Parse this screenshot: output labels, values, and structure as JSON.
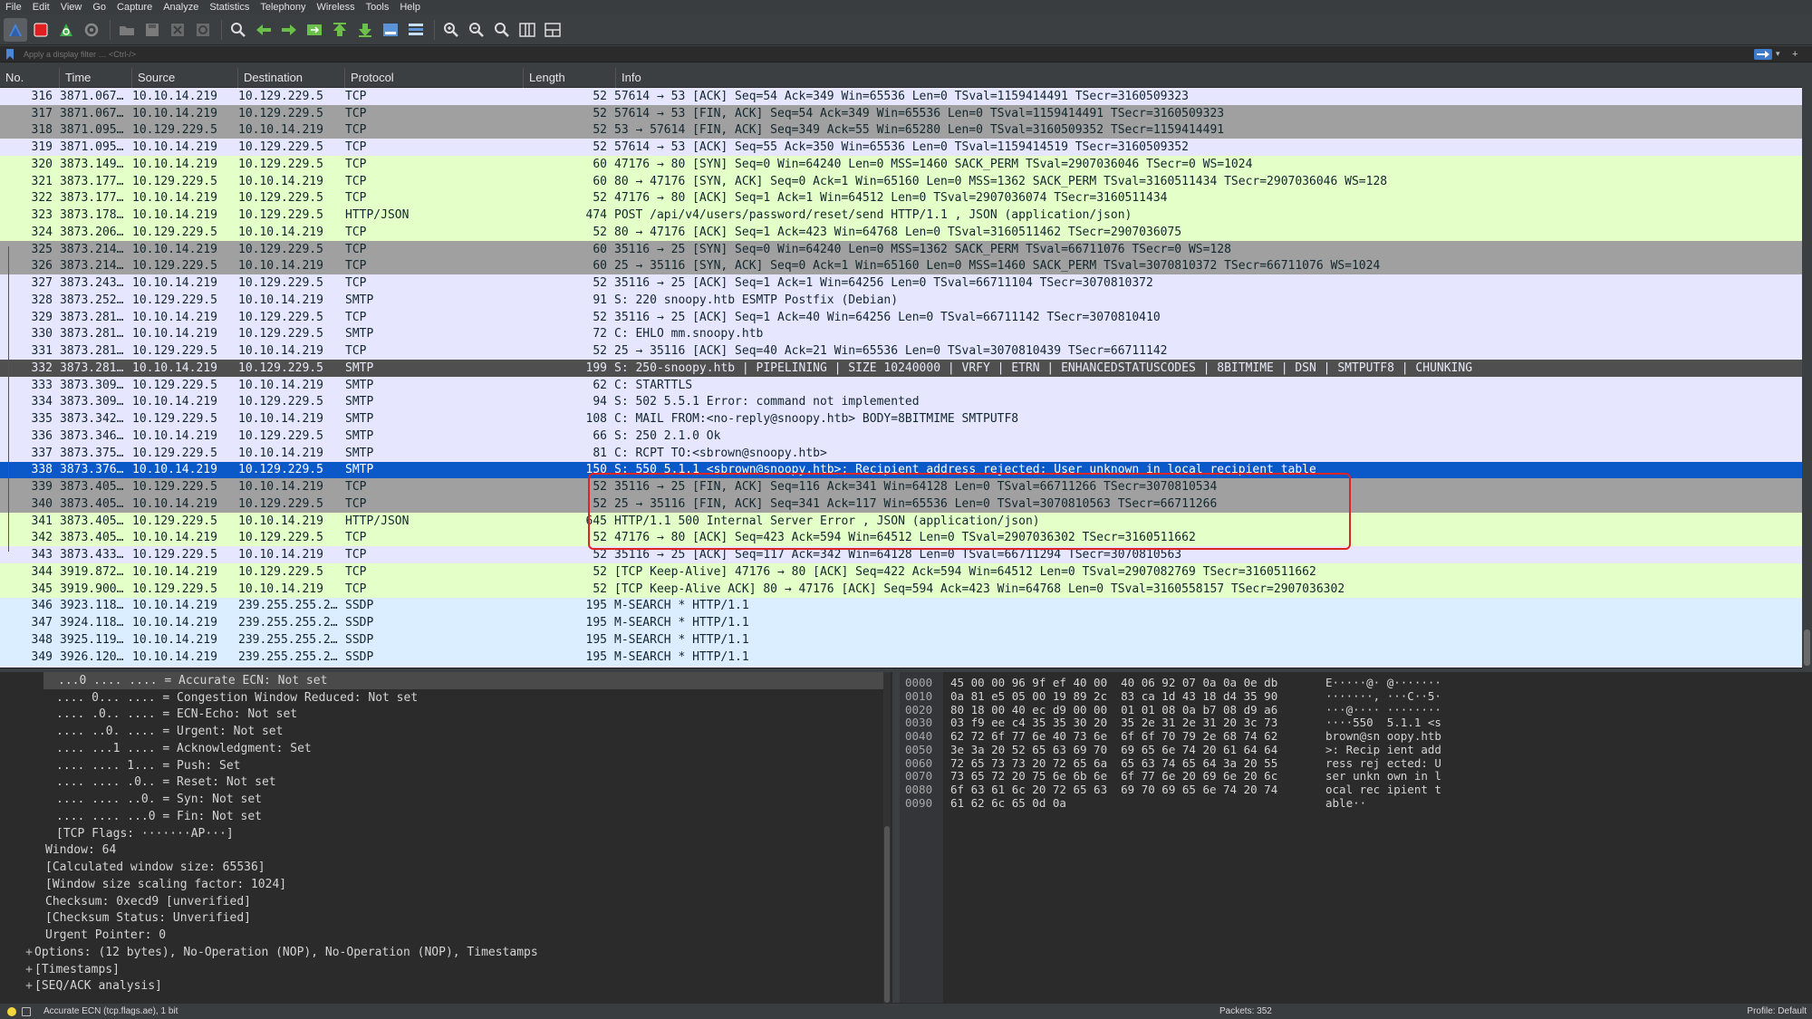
{
  "menu": [
    "File",
    "Edit",
    "View",
    "Go",
    "Capture",
    "Analyze",
    "Statistics",
    "Telephony",
    "Wireless",
    "Tools",
    "Help"
  ],
  "toolbar": {
    "icons": [
      "shark-fin-start-icon",
      "stop-icon",
      "restart-icon",
      "options-gear-icon",
      "open-folder-icon",
      "save-icon",
      "close-file-icon",
      "reload-icon",
      "find-icon",
      "back-arrow-icon",
      "forward-arrow-icon",
      "goto-packet-icon",
      "first-packet-icon",
      "last-packet-icon",
      "autoscroll-icon",
      "colorize-icon",
      "zoom-in-icon",
      "zoom-out-icon",
      "normal-size-icon",
      "resize-columns-icon",
      "layout-icon"
    ]
  },
  "filter": {
    "placeholder": "Apply a display filter … <Ctrl-/>"
  },
  "columns": {
    "no": "No.",
    "time": "Time",
    "source": "Source",
    "destination": "Destination",
    "protocol": "Protocol",
    "length": "Length",
    "info": "Info"
  },
  "colors": {
    "tcp_light": "#e7e6ff",
    "tcp_dark": "#a0a0a0",
    "http": "#e4ffc7",
    "ssdp": "#daeeff",
    "smtp": "#e7e6ff",
    "selected": "#0b58c8",
    "marked_dark": "#4f4f4f",
    "highlight": "#e02424"
  },
  "packets": [
    {
      "no": "316",
      "time": "3871.067…",
      "src": "10.10.14.219",
      "dst": "10.129.229.5",
      "proto": "TCP",
      "len": "52",
      "info": "57614 → 53 [ACK] Seq=54 Ack=349 Win=65536 Len=0 TSval=1159414491 TSecr=3160509323",
      "bg": "#e7e6ff",
      "fg": "#12272e"
    },
    {
      "no": "317",
      "time": "3871.067…",
      "src": "10.10.14.219",
      "dst": "10.129.229.5",
      "proto": "TCP",
      "len": "52",
      "info": "57614 → 53 [FIN, ACK] Seq=54 Ack=349 Win=65536 Len=0 TSval=1159414491 TSecr=3160509323",
      "bg": "#a0a0a0",
      "fg": "#12272e"
    },
    {
      "no": "318",
      "time": "3871.095…",
      "src": "10.129.229.5",
      "dst": "10.10.14.219",
      "proto": "TCP",
      "len": "52",
      "info": "53 → 57614 [FIN, ACK] Seq=349 Ack=55 Win=65280 Len=0 TSval=3160509352 TSecr=1159414491",
      "bg": "#a0a0a0",
      "fg": "#12272e"
    },
    {
      "no": "319",
      "time": "3871.095…",
      "src": "10.10.14.219",
      "dst": "10.129.229.5",
      "proto": "TCP",
      "len": "52",
      "info": "57614 → 53 [ACK] Seq=55 Ack=350 Win=65536 Len=0 TSval=1159414519 TSecr=3160509352",
      "bg": "#e7e6ff",
      "fg": "#12272e"
    },
    {
      "no": "320",
      "time": "3873.149…",
      "src": "10.10.14.219",
      "dst": "10.129.229.5",
      "proto": "TCP",
      "len": "60",
      "info": "47176 → 80 [SYN] Seq=0 Win=64240 Len=0 MSS=1460 SACK_PERM TSval=2907036046 TSecr=0 WS=1024",
      "bg": "#e4ffc7",
      "fg": "#12272e"
    },
    {
      "no": "321",
      "time": "3873.177…",
      "src": "10.129.229.5",
      "dst": "10.10.14.219",
      "proto": "TCP",
      "len": "60",
      "info": "80 → 47176 [SYN, ACK] Seq=0 Ack=1 Win=65160 Len=0 MSS=1362 SACK_PERM TSval=3160511434 TSecr=2907036046 WS=128",
      "bg": "#e4ffc7",
      "fg": "#12272e"
    },
    {
      "no": "322",
      "time": "3873.177…",
      "src": "10.10.14.219",
      "dst": "10.129.229.5",
      "proto": "TCP",
      "len": "52",
      "info": "47176 → 80 [ACK] Seq=1 Ack=1 Win=64512 Len=0 TSval=2907036074 TSecr=3160511434",
      "bg": "#e4ffc7",
      "fg": "#12272e"
    },
    {
      "no": "323",
      "time": "3873.178…",
      "src": "10.10.14.219",
      "dst": "10.129.229.5",
      "proto": "HTTP/JSON",
      "len": "474",
      "info": "POST /api/v4/users/password/reset/send HTTP/1.1 , JSON (application/json)",
      "bg": "#e4ffc7",
      "fg": "#12272e"
    },
    {
      "no": "324",
      "time": "3873.206…",
      "src": "10.129.229.5",
      "dst": "10.10.14.219",
      "proto": "TCP",
      "len": "52",
      "info": "80 → 47176 [ACK] Seq=1 Ack=423 Win=64768 Len=0 TSval=3160511462 TSecr=2907036075",
      "bg": "#e4ffc7",
      "fg": "#12272e"
    },
    {
      "no": "325",
      "time": "3873.214…",
      "src": "10.10.14.219",
      "dst": "10.129.229.5",
      "proto": "TCP",
      "len": "60",
      "info": "35116 → 25 [SYN] Seq=0 Win=64240 Len=0 MSS=1362 SACK_PERM TSval=66711076 TSecr=0 WS=128",
      "bg": "#a0a0a0",
      "fg": "#12272e"
    },
    {
      "no": "326",
      "time": "3873.214…",
      "src": "10.129.229.5",
      "dst": "10.10.14.219",
      "proto": "TCP",
      "len": "60",
      "info": "25 → 35116 [SYN, ACK] Seq=0 Ack=1 Win=65160 Len=0 MSS=1460 SACK_PERM TSval=3070810372 TSecr=66711076 WS=1024",
      "bg": "#a0a0a0",
      "fg": "#12272e"
    },
    {
      "no": "327",
      "time": "3873.243…",
      "src": "10.10.14.219",
      "dst": "10.129.229.5",
      "proto": "TCP",
      "len": "52",
      "info": "35116 → 25 [ACK] Seq=1 Ack=1 Win=64256 Len=0 TSval=66711104 TSecr=3070810372",
      "bg": "#e7e6ff",
      "fg": "#12272e"
    },
    {
      "no": "328",
      "time": "3873.252…",
      "src": "10.129.229.5",
      "dst": "10.10.14.219",
      "proto": "SMTP",
      "len": "91",
      "info": "S: 220 snoopy.htb ESMTP Postfix (Debian)",
      "bg": "#e7e6ff",
      "fg": "#12272e"
    },
    {
      "no": "329",
      "time": "3873.281…",
      "src": "10.10.14.219",
      "dst": "10.129.229.5",
      "proto": "TCP",
      "len": "52",
      "info": "35116 → 25 [ACK] Seq=1 Ack=40 Win=64256 Len=0 TSval=66711142 TSecr=3070810410",
      "bg": "#e7e6ff",
      "fg": "#12272e"
    },
    {
      "no": "330",
      "time": "3873.281…",
      "src": "10.10.14.219",
      "dst": "10.129.229.5",
      "proto": "SMTP",
      "len": "72",
      "info": "C: EHLO mm.snoopy.htb",
      "bg": "#e7e6ff",
      "fg": "#12272e"
    },
    {
      "no": "331",
      "time": "3873.281…",
      "src": "10.129.229.5",
      "dst": "10.10.14.219",
      "proto": "TCP",
      "len": "52",
      "info": "25 → 35116 [ACK] Seq=40 Ack=21 Win=65536 Len=0 TSval=3070810439 TSecr=66711142",
      "bg": "#e7e6ff",
      "fg": "#12272e"
    },
    {
      "no": "332",
      "time": "3873.281…",
      "src": "10.10.14.219",
      "dst": "10.129.229.5",
      "proto": "SMTP",
      "len": "199",
      "info": "S: 250-snoopy.htb | PIPELINING | SIZE 10240000 | VRFY | ETRN | ENHANCEDSTATUSCODES | 8BITMIME | DSN | SMTPUTF8 | CHUNKING",
      "bg": "#4f4f4f",
      "fg": "#e8e8f8"
    },
    {
      "no": "333",
      "time": "3873.309…",
      "src": "10.129.229.5",
      "dst": "10.10.14.219",
      "proto": "SMTP",
      "len": "62",
      "info": "C: STARTTLS",
      "bg": "#e7e6ff",
      "fg": "#12272e"
    },
    {
      "no": "334",
      "time": "3873.309…",
      "src": "10.10.14.219",
      "dst": "10.129.229.5",
      "proto": "SMTP",
      "len": "94",
      "info": "S: 502 5.5.1 Error: command not implemented",
      "bg": "#e7e6ff",
      "fg": "#12272e"
    },
    {
      "no": "335",
      "time": "3873.342…",
      "src": "10.129.229.5",
      "dst": "10.10.14.219",
      "proto": "SMTP",
      "len": "108",
      "info": "C: MAIL FROM:<no-reply@snoopy.htb> BODY=8BITMIME SMTPUTF8",
      "bg": "#e7e6ff",
      "fg": "#12272e"
    },
    {
      "no": "336",
      "time": "3873.346…",
      "src": "10.10.14.219",
      "dst": "10.129.229.5",
      "proto": "SMTP",
      "len": "66",
      "info": "S: 250 2.1.0 Ok",
      "bg": "#e7e6ff",
      "fg": "#12272e"
    },
    {
      "no": "337",
      "time": "3873.375…",
      "src": "10.129.229.5",
      "dst": "10.10.14.219",
      "proto": "SMTP",
      "len": "81",
      "info": "C: RCPT TO:<sbrown@snoopy.htb>",
      "bg": "#e7e6ff",
      "fg": "#12272e"
    },
    {
      "no": "338",
      "time": "3873.376…",
      "src": "10.10.14.219",
      "dst": "10.129.229.5",
      "proto": "SMTP",
      "len": "150",
      "info": "S: 550 5.1.1 <sbrown@snoopy.htb>: Recipient address rejected: User unknown in local recipient table",
      "bg": "#0b58c8",
      "fg": "#ffffff"
    },
    {
      "no": "339",
      "time": "3873.405…",
      "src": "10.129.229.5",
      "dst": "10.10.14.219",
      "proto": "TCP",
      "len": "52",
      "info": "35116 → 25 [FIN, ACK] Seq=116 Ack=341 Win=64128 Len=0 TSval=66711266 TSecr=3070810534",
      "bg": "#a0a0a0",
      "fg": "#12272e"
    },
    {
      "no": "340",
      "time": "3873.405…",
      "src": "10.10.14.219",
      "dst": "10.129.229.5",
      "proto": "TCP",
      "len": "52",
      "info": "25 → 35116 [FIN, ACK] Seq=341 Ack=117 Win=65536 Len=0 TSval=3070810563 TSecr=66711266",
      "bg": "#a0a0a0",
      "fg": "#12272e"
    },
    {
      "no": "341",
      "time": "3873.405…",
      "src": "10.129.229.5",
      "dst": "10.10.14.219",
      "proto": "HTTP/JSON",
      "len": "645",
      "info": "HTTP/1.1 500 Internal Server Error , JSON (application/json)",
      "bg": "#e4ffc7",
      "fg": "#12272e"
    },
    {
      "no": "342",
      "time": "3873.405…",
      "src": "10.10.14.219",
      "dst": "10.129.229.5",
      "proto": "TCP",
      "len": "52",
      "info": "47176 → 80 [ACK] Seq=423 Ack=594 Win=64512 Len=0 TSval=2907036302 TSecr=3160511662",
      "bg": "#e4ffc7",
      "fg": "#12272e"
    },
    {
      "no": "343",
      "time": "3873.433…",
      "src": "10.129.229.5",
      "dst": "10.10.14.219",
      "proto": "TCP",
      "len": "52",
      "info": "35116 → 25 [ACK] Seq=117 Ack=342 Win=64128 Len=0 TSval=66711294 TSecr=3070810563",
      "bg": "#e7e6ff",
      "fg": "#12272e"
    },
    {
      "no": "344",
      "time": "3919.872…",
      "src": "10.10.14.219",
      "dst": "10.129.229.5",
      "proto": "TCP",
      "len": "52",
      "info": "[TCP Keep-Alive] 47176 → 80 [ACK] Seq=422 Ack=594 Win=64512 Len=0 TSval=2907082769 TSecr=3160511662",
      "bg": "#e4ffc7",
      "fg": "#12272e"
    },
    {
      "no": "345",
      "time": "3919.900…",
      "src": "10.129.229.5",
      "dst": "10.10.14.219",
      "proto": "TCP",
      "len": "52",
      "info": "[TCP Keep-Alive ACK] 80 → 47176 [ACK] Seq=594 Ack=423 Win=64768 Len=0 TSval=3160558157 TSecr=2907036302",
      "bg": "#e4ffc7",
      "fg": "#12272e"
    },
    {
      "no": "346",
      "time": "3923.118…",
      "src": "10.10.14.219",
      "dst": "239.255.255.2…",
      "proto": "SSDP",
      "len": "195",
      "info": "M-SEARCH * HTTP/1.1",
      "bg": "#daeeff",
      "fg": "#12272e"
    },
    {
      "no": "347",
      "time": "3924.118…",
      "src": "10.10.14.219",
      "dst": "239.255.255.2…",
      "proto": "SSDP",
      "len": "195",
      "info": "M-SEARCH * HTTP/1.1",
      "bg": "#daeeff",
      "fg": "#12272e"
    },
    {
      "no": "348",
      "time": "3925.119…",
      "src": "10.10.14.219",
      "dst": "239.255.255.2…",
      "proto": "SSDP",
      "len": "195",
      "info": "M-SEARCH * HTTP/1.1",
      "bg": "#daeeff",
      "fg": "#12272e"
    },
    {
      "no": "349",
      "time": "3926.120…",
      "src": "10.10.14.219",
      "dst": "239.255.255.2…",
      "proto": "SSDP",
      "len": "195",
      "info": "M-SEARCH * HTTP/1.1",
      "bg": "#daeeff",
      "fg": "#12272e"
    }
  ],
  "details": [
    {
      "indent": 3,
      "exp": "",
      "text": "...0 .... .... = Accurate ECN: Not set",
      "selected": true
    },
    {
      "indent": 3,
      "exp": "",
      "text": ".... 0... .... = Congestion Window Reduced: Not set",
      "selected": false
    },
    {
      "indent": 3,
      "exp": "",
      "text": ".... .0.. .... = ECN-Echo: Not set",
      "selected": false
    },
    {
      "indent": 3,
      "exp": "",
      "text": ".... ..0. .... = Urgent: Not set",
      "selected": false
    },
    {
      "indent": 3,
      "exp": "",
      "text": ".... ...1 .... = Acknowledgment: Set",
      "selected": false
    },
    {
      "indent": 3,
      "exp": "",
      "text": ".... .... 1... = Push: Set",
      "selected": false
    },
    {
      "indent": 3,
      "exp": "",
      "text": ".... .... .0.. = Reset: Not set",
      "selected": false
    },
    {
      "indent": 3,
      "exp": "",
      "text": ".... .... ..0. = Syn: Not set",
      "selected": false
    },
    {
      "indent": 3,
      "exp": "",
      "text": ".... .... ...0 = Fin: Not set",
      "selected": false
    },
    {
      "indent": 3,
      "exp": "",
      "text": "[TCP Flags: ·······AP···]",
      "selected": false
    },
    {
      "indent": 2,
      "exp": "",
      "text": "Window: 64",
      "selected": false
    },
    {
      "indent": 2,
      "exp": "",
      "text": "[Calculated window size: 65536]",
      "selected": false
    },
    {
      "indent": 2,
      "exp": "",
      "text": "[Window size scaling factor: 1024]",
      "selected": false
    },
    {
      "indent": 2,
      "exp": "",
      "text": "Checksum: 0xecd9 [unverified]",
      "selected": false
    },
    {
      "indent": 2,
      "exp": "",
      "text": "[Checksum Status: Unverified]",
      "selected": false
    },
    {
      "indent": 2,
      "exp": "",
      "text": "Urgent Pointer: 0",
      "selected": false
    },
    {
      "indent": 1,
      "exp": "+",
      "text": "Options: (12 bytes), No-Operation (NOP), No-Operation (NOP), Timestamps",
      "selected": false
    },
    {
      "indent": 1,
      "exp": "+",
      "text": "[Timestamps]",
      "selected": false
    },
    {
      "indent": 1,
      "exp": "+",
      "text": "[SEQ/ACK analysis]",
      "selected": false
    }
  ],
  "bytes": [
    {
      "off": "0000",
      "hex": "45 00 00 96 9f ef 40 00  40 06 92 07 0a 0a 0e db",
      "asc": "E·····@· @·······"
    },
    {
      "off": "0010",
      "hex": "0a 81 e5 05 00 19 89 2c  83 ca 1d 43 18 d4 35 90",
      "asc": "·······, ···C··5·"
    },
    {
      "off": "0020",
      "hex": "80 18 00 40 ec d9 00 00  01 01 08 0a b7 08 d9 a6",
      "asc": "···@···· ········"
    },
    {
      "off": "0030",
      "hex": "03 f9 ee c4 35 35 30 20  35 2e 31 2e 31 20 3c 73",
      "asc": "····550  5.1.1 <s"
    },
    {
      "off": "0040",
      "hex": "62 72 6f 77 6e 40 73 6e  6f 6f 70 79 2e 68 74 62",
      "asc": "brown@sn oopy.htb"
    },
    {
      "off": "0050",
      "hex": "3e 3a 20 52 65 63 69 70  69 65 6e 74 20 61 64 64",
      "asc": ">: Recip ient add"
    },
    {
      "off": "0060",
      "hex": "72 65 73 73 20 72 65 6a  65 63 74 65 64 3a 20 55",
      "asc": "ress rej ected: U"
    },
    {
      "off": "0070",
      "hex": "73 65 72 20 75 6e 6b 6e  6f 77 6e 20 69 6e 20 6c",
      "asc": "ser unkn own in l"
    },
    {
      "off": "0080",
      "hex": "6f 63 61 6c 20 72 65 63  69 70 69 65 6e 74 20 74",
      "asc": "ocal rec ipient t"
    },
    {
      "off": "0090",
      "hex": "61 62 6c 65 0d 0a",
      "asc": "able··"
    }
  ],
  "status": {
    "field": "Accurate ECN (tcp.flags.ae), 1 bit",
    "packets": "Packets: 352",
    "profile": "Profile: Default"
  }
}
